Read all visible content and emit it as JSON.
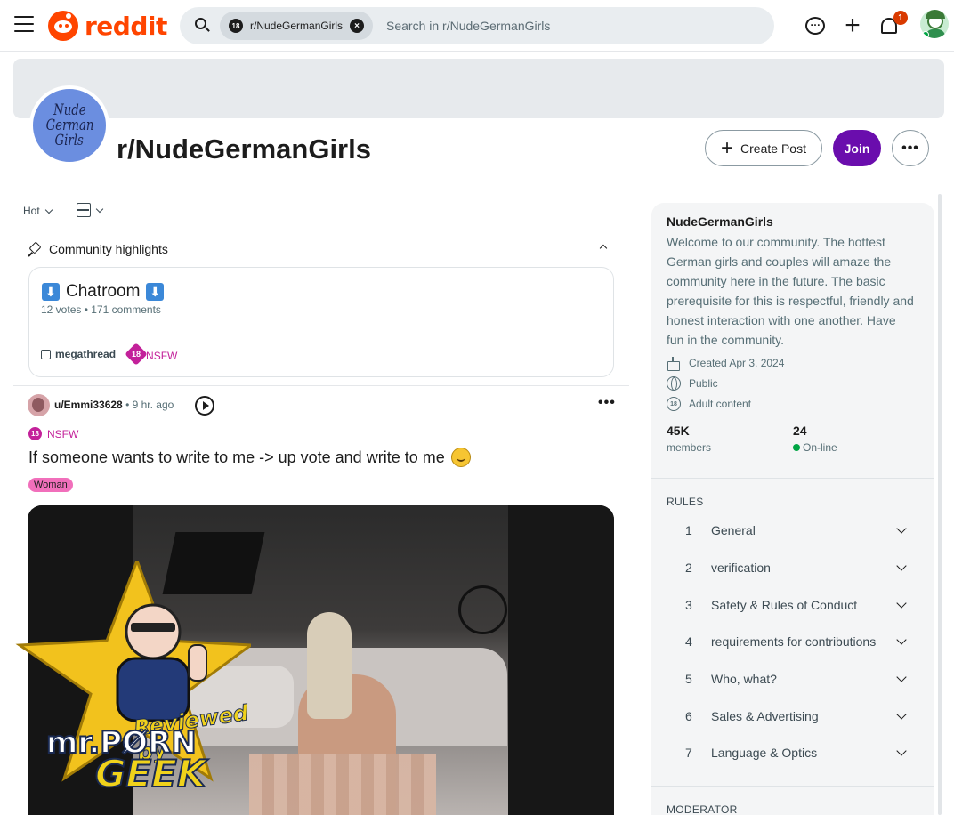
{
  "header": {
    "logo_text": "reddit",
    "search_chip": "r/NudeGermanGirls",
    "search_chip_badge": "18",
    "search_placeholder": "Search in r/NudeGermanGirls",
    "notification_count": "1"
  },
  "community": {
    "icon_text": [
      "Nude",
      "German",
      "Girls"
    ],
    "name": "r/NudeGermanGirls",
    "create_post_label": "Create Post",
    "join_label": "Join",
    "more_label": "•••"
  },
  "feed": {
    "sort_label": "Hot",
    "highlights_label": "Community highlights",
    "highlight": {
      "title": "Chatroom",
      "emoji": "⬇",
      "meta": "12 votes • 171 comments",
      "flair": "megathread",
      "nsfw_badge": "18",
      "nsfw_label": "NSFW"
    },
    "post": {
      "author": "u/Emmi33628",
      "age": "• 9 hr. ago",
      "more_label": "•••",
      "nsfw_badge": "18",
      "nsfw_label": "NSFW",
      "title": "If someone wants to write to me -> up vote and write to me",
      "flair": "Woman"
    }
  },
  "watermark": {
    "line1": "Reviewed by",
    "line2": "mr.PØRN",
    "line3": "GEEK"
  },
  "sidebar": {
    "name": "NudeGermanGirls",
    "description": "Welcome to our community. The hottest German girls and couples will amaze the community here in the future. The basic prerequisite for this is respectful, friendly and honest interaction with one another. Have fun in the community.",
    "created": "Created Apr 3, 2024",
    "visibility": "Public",
    "content_type": "Adult content",
    "adult_badge": "18",
    "members_count": "45K",
    "members_label": "members",
    "online_count": "24",
    "online_label": "On-line",
    "rules_heading": "RULES",
    "rules": [
      {
        "num": "1",
        "label": "General"
      },
      {
        "num": "2",
        "label": "verification"
      },
      {
        "num": "3",
        "label": "Safety & Rules of Conduct"
      },
      {
        "num": "4",
        "label": "requirements for contributions"
      },
      {
        "num": "5",
        "label": "Who, what?"
      },
      {
        "num": "6",
        "label": "Sales & Advertising"
      },
      {
        "num": "7",
        "label": "Language & Optics"
      }
    ],
    "moderator_heading": "MODERATOR"
  },
  "colors": {
    "brand": "#ff4500",
    "join": "#6a0dad",
    "nsfw": "#c3219a",
    "online": "#00a544",
    "flair": "#f16fbb"
  }
}
